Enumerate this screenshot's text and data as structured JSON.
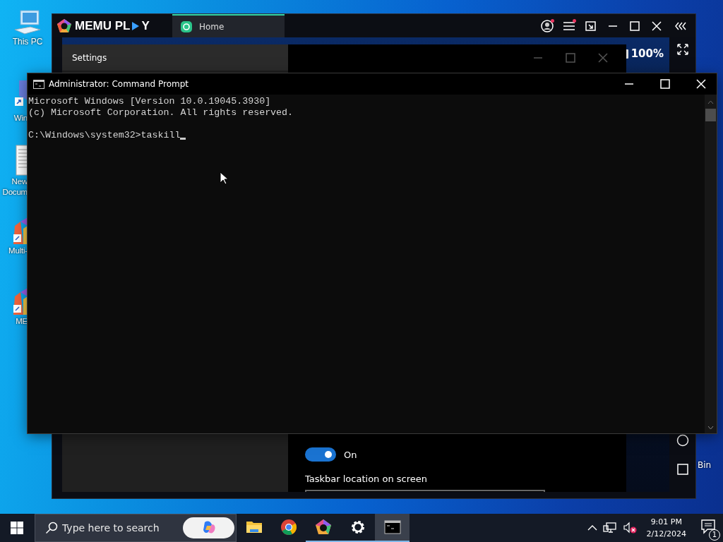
{
  "desktop_icons": [
    {
      "kind": "computer",
      "lines": [
        "This PC"
      ]
    },
    {
      "kind": "shortcut",
      "lines": [
        "Win"
      ]
    },
    {
      "kind": "document",
      "lines": [
        "New",
        "Docum"
      ]
    },
    {
      "kind": "app",
      "lines": [
        "Multi-"
      ]
    },
    {
      "kind": "app",
      "lines": [
        "ME"
      ]
    }
  ],
  "recycle_bin_label": "Bin",
  "memu": {
    "logo": [
      "MEMU PL",
      "Y"
    ],
    "tabs": [
      {
        "label": "Home",
        "selected": true
      }
    ],
    "title_buttons": [
      {
        "kind": "account",
        "badge": true
      },
      {
        "kind": "menu",
        "badge": true
      },
      {
        "kind": "screen",
        "badge": false
      },
      {
        "kind": "minimize",
        "badge": false
      },
      {
        "kind": "maximize",
        "badge": false
      },
      {
        "kind": "close",
        "badge": false
      },
      {
        "kind": "collapse",
        "badge": false
      }
    ],
    "battery": "100%",
    "side_tools_top": [
      {
        "kind": "fullscreen"
      }
    ],
    "side_tools_bottom": [
      {
        "kind": "home"
      },
      {
        "kind": "recents"
      }
    ],
    "settings": {
      "title": "Settings",
      "toggle": {
        "on": true,
        "label": "On"
      },
      "section_label": "Taskbar location on screen"
    }
  },
  "cmd": {
    "title": "Administrator: Command Prompt",
    "output": [
      "Microsoft Windows [Version 10.0.19045.3930]",
      "(c) Microsoft Corporation. All rights reserved."
    ],
    "prompt": "C:\\Windows\\system32>taskill"
  },
  "taskbar": {
    "search_placeholder": "Type here to search",
    "apps": [
      {
        "kind": "explorer",
        "running": false,
        "active": false
      },
      {
        "kind": "chrome",
        "running": false,
        "active": false
      },
      {
        "kind": "memu",
        "running": true,
        "active": false
      },
      {
        "kind": "settings",
        "running": true,
        "active": false
      },
      {
        "kind": "cmd",
        "running": true,
        "active": true
      }
    ],
    "time": "9:01 PM",
    "date": "2/12/2024",
    "notifications": "1"
  }
}
